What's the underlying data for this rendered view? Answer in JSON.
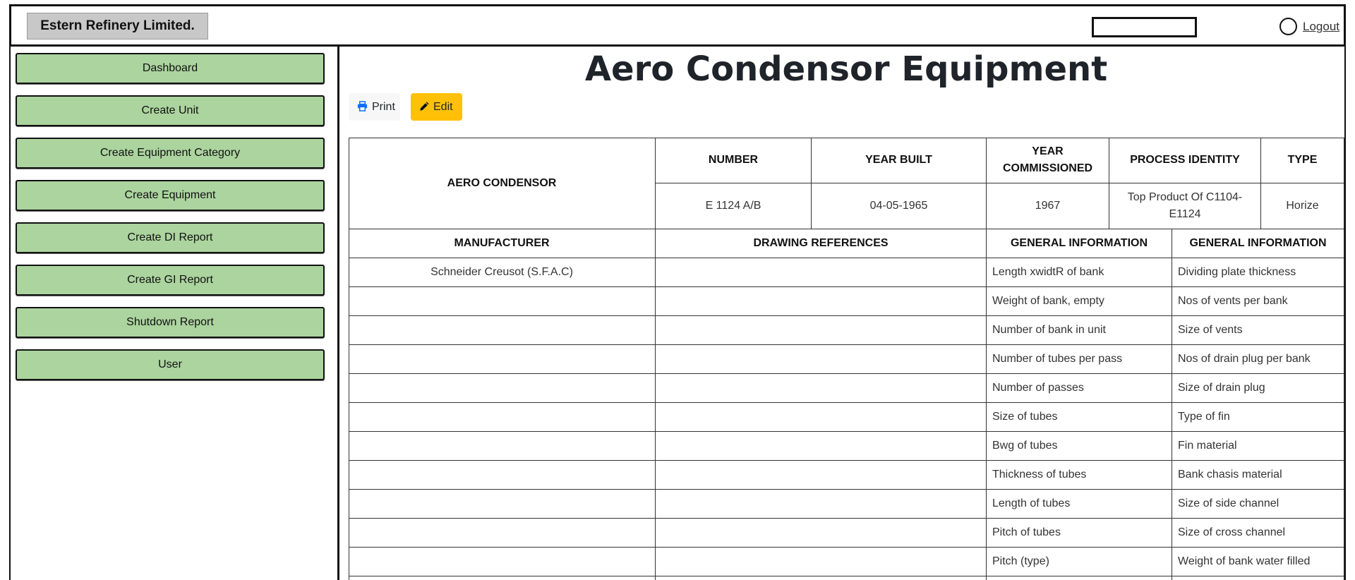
{
  "header": {
    "brand": "Estern Refinery Limited.",
    "logout_label": "Logout"
  },
  "sidebar": {
    "items": [
      {
        "label": "Dashboard"
      },
      {
        "label": "Create Unit"
      },
      {
        "label": "Create Equipment Category"
      },
      {
        "label": "Create Equipment"
      },
      {
        "label": "Create DI Report"
      },
      {
        "label": "Create GI Report"
      },
      {
        "label": "Shutdown Report"
      },
      {
        "label": "User"
      }
    ]
  },
  "main": {
    "title": "Aero Condensor Equipment",
    "print_label": "Print",
    "edit_label": "Edit",
    "print_icon": "printer-icon",
    "edit_icon": "pencil-icon",
    "accent_color": "#ffc107",
    "sidebar_color": "#abd49e"
  },
  "table": {
    "equipment_label": "AERO CONDENSOR",
    "top_headers": [
      "NUMBER",
      "YEAR BUILT",
      "YEAR COMMISSIONED",
      "PROCESS IDENTITY",
      "TYPE"
    ],
    "top_values": [
      "E 1124 A/B",
      "04-05-1965",
      "1967",
      "Top Product Of C1104-E1124",
      "Horize"
    ],
    "second_headers": [
      "MANUFACTURER",
      "DRAWING REFERENCES",
      "GENERAL INFORMATION",
      "GENERAL INFORMATION"
    ],
    "manufacturer": "Schneider Creusot (S.F.A.C)",
    "general_info_1": [
      "Length xwidtR of bank",
      "Weight of bank, empty",
      "Number of bank in unit",
      "Number of tubes per pass",
      "Number of passes",
      "Size of tubes",
      "Bwg of tubes",
      "Thickness of tubes",
      "Length of tubes",
      "Pitch of tubes",
      "Pitch (type)"
    ],
    "general_info_2": [
      "Dividing plate thickness",
      "Nos of vents per bank",
      "Size of vents",
      "Nos of drain plug per bank",
      "Size of drain plug",
      "Type of fin",
      "Fin material",
      "Bank chasis material",
      "Size of side channel",
      "Size of cross channel",
      "Weight of bank water filled"
    ]
  }
}
